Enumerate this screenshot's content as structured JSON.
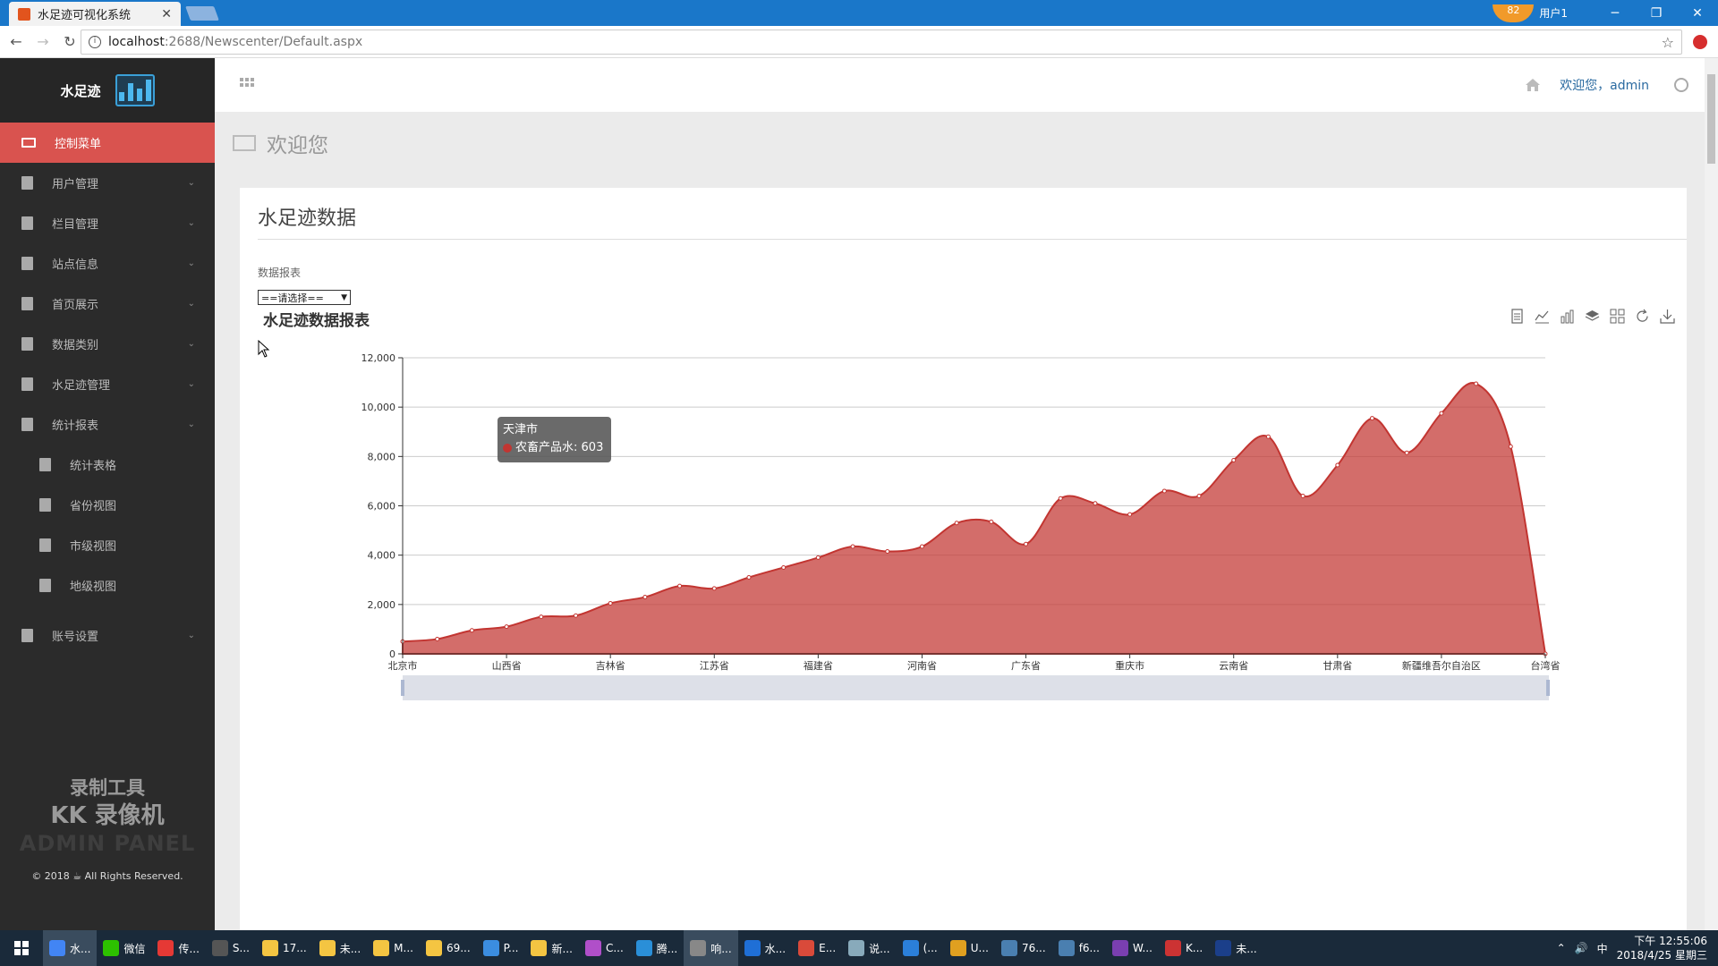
{
  "browser": {
    "tab_title": "水足迹可视化系统",
    "tab_close": "✕",
    "user_badge_count": "82",
    "user_label": "用户1",
    "url_host": "localhost",
    "url_path": ":2688/Newscenter/Default.aspx",
    "colors": {
      "tabbar": "#1a77c9",
      "favicon": "#e2541d"
    }
  },
  "sidebar": {
    "brand": "水足迹",
    "items": [
      {
        "label": "控制菜单",
        "active": true
      },
      {
        "label": "用户管理"
      },
      {
        "label": "栏目管理"
      },
      {
        "label": "站点信息"
      },
      {
        "label": "首页展示"
      },
      {
        "label": "数据类别"
      },
      {
        "label": "水足迹管理"
      },
      {
        "label": "统计报表"
      }
    ],
    "sub_items": [
      {
        "label": "统计表格"
      },
      {
        "label": "省份视图"
      },
      {
        "label": "市级视图"
      },
      {
        "label": "地级视图"
      }
    ],
    "account": "账号设置",
    "watermark": [
      "录制工具",
      "KK 录像机",
      "ADMIN PANEL"
    ],
    "copyright": "© 2018 ☕ All Rights Reserved.",
    "active_color": "#d9534f"
  },
  "topnav": {
    "welcome_user": "欢迎您，admin"
  },
  "main": {
    "welcome": "欢迎您",
    "panel_title": "水足迹数据",
    "field_label": "数据报表",
    "select_value": "==请选择==",
    "chart_title": "水足迹数据报表",
    "toolbox_icons": [
      "data-view-icon",
      "line-switch-icon",
      "bar-switch-icon",
      "stack-icon",
      "tiled-icon",
      "refresh-icon",
      "download-icon"
    ]
  },
  "tooltip": {
    "title": "天津市",
    "series": "农畜产品水",
    "value": "603"
  },
  "chart_data": {
    "type": "area",
    "x_tick_labels": [
      "北京市",
      "山西省",
      "吉林省",
      "江苏省",
      "福建省",
      "河南省",
      "广东省",
      "重庆市",
      "云南省",
      "甘肃省",
      "新疆维吾尔自治区",
      "台湾省"
    ],
    "values": [
      500,
      600,
      950,
      1100,
      1500,
      1550,
      2050,
      2300,
      2750,
      2650,
      3100,
      3500,
      3900,
      4350,
      4150,
      4350,
      5300,
      5350,
      4450,
      6300,
      6100,
      5650,
      6600,
      6400,
      7850,
      8800,
      6400,
      7650,
      9550,
      8150,
      9750,
      10950,
      8400,
      0
    ],
    "ylim": [
      0,
      12000
    ],
    "y_ticks": [
      "0",
      "2,000",
      "4,000",
      "6,000",
      "8,000",
      "10,000",
      "12,000"
    ],
    "series": [
      {
        "name": "农畜产品水",
        "color": "#c23531"
      }
    ],
    "smooth": true,
    "grid": true,
    "data_zoom": true
  },
  "taskbar": {
    "tasks": [
      "水...",
      "微信",
      "传...",
      "S...",
      "17...",
      "未...",
      "M...",
      "69...",
      "P...",
      "新...",
      "C...",
      "腾...",
      "响...",
      "水...",
      "E...",
      "说...",
      "(...",
      "U...",
      "76...",
      "f6...",
      "W...",
      "K...",
      "未..."
    ],
    "time": "下午 12:55:06",
    "date": "2018/4/25 星期三",
    "ime": "中"
  }
}
